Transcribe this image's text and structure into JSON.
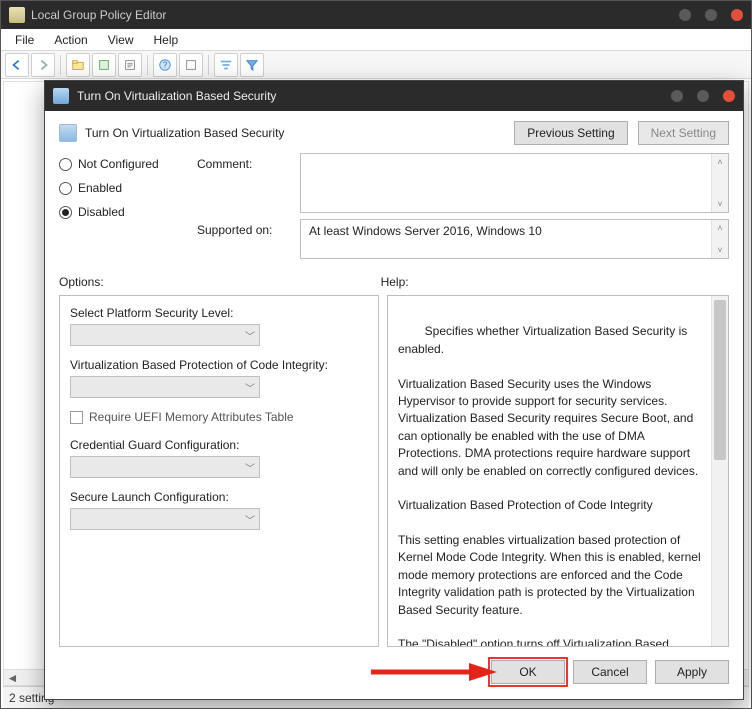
{
  "bg": {
    "title": "Local Group Policy Editor",
    "menu": [
      "File",
      "Action",
      "View",
      "Help"
    ],
    "status": "2 setting",
    "toolbar_icons": [
      "back",
      "forward",
      "up",
      "refresh",
      "export",
      "help",
      "props",
      "filter-list",
      "filter"
    ]
  },
  "dialog": {
    "title": "Turn On Virtualization Based Security",
    "policy_label": "Turn On Virtualization Based Security",
    "prev_btn": "Previous Setting",
    "next_btn": "Next Setting",
    "states": {
      "not_configured": "Not Configured",
      "enabled": "Enabled",
      "disabled": "Disabled",
      "selected": "disabled"
    },
    "comment_label": "Comment:",
    "supported_label": "Supported on:",
    "supported_text": "At least Windows Server 2016, Windows 10",
    "options_label": "Options:",
    "help_label": "Help:",
    "options": {
      "plat_sec": "Select Platform Security Level:",
      "vbp_ci": "Virtualization Based Protection of Code Integrity:",
      "uefi_chk": "Require UEFI Memory Attributes Table",
      "cred_guard": "Credential Guard Configuration:",
      "secure_launch": "Secure Launch Configuration:"
    },
    "help_text": "Specifies whether Virtualization Based Security is enabled.\n\nVirtualization Based Security uses the Windows Hypervisor to provide support for security services. Virtualization Based Security requires Secure Boot, and can optionally be enabled with the use of DMA Protections. DMA protections require hardware support and will only be enabled on correctly configured devices.\n\nVirtualization Based Protection of Code Integrity\n\nThis setting enables virtualization based protection of Kernel Mode Code Integrity. When this is enabled, kernel mode memory protections are enforced and the Code Integrity validation path is protected by the Virtualization Based Security feature.\n\nThe \"Disabled\" option turns off Virtualization Based Protection of Code Integrity remotely if it was previously turned on with the \"Enabled without lock\" option.\n",
    "footer": {
      "ok": "OK",
      "cancel": "Cancel",
      "apply": "Apply"
    }
  }
}
